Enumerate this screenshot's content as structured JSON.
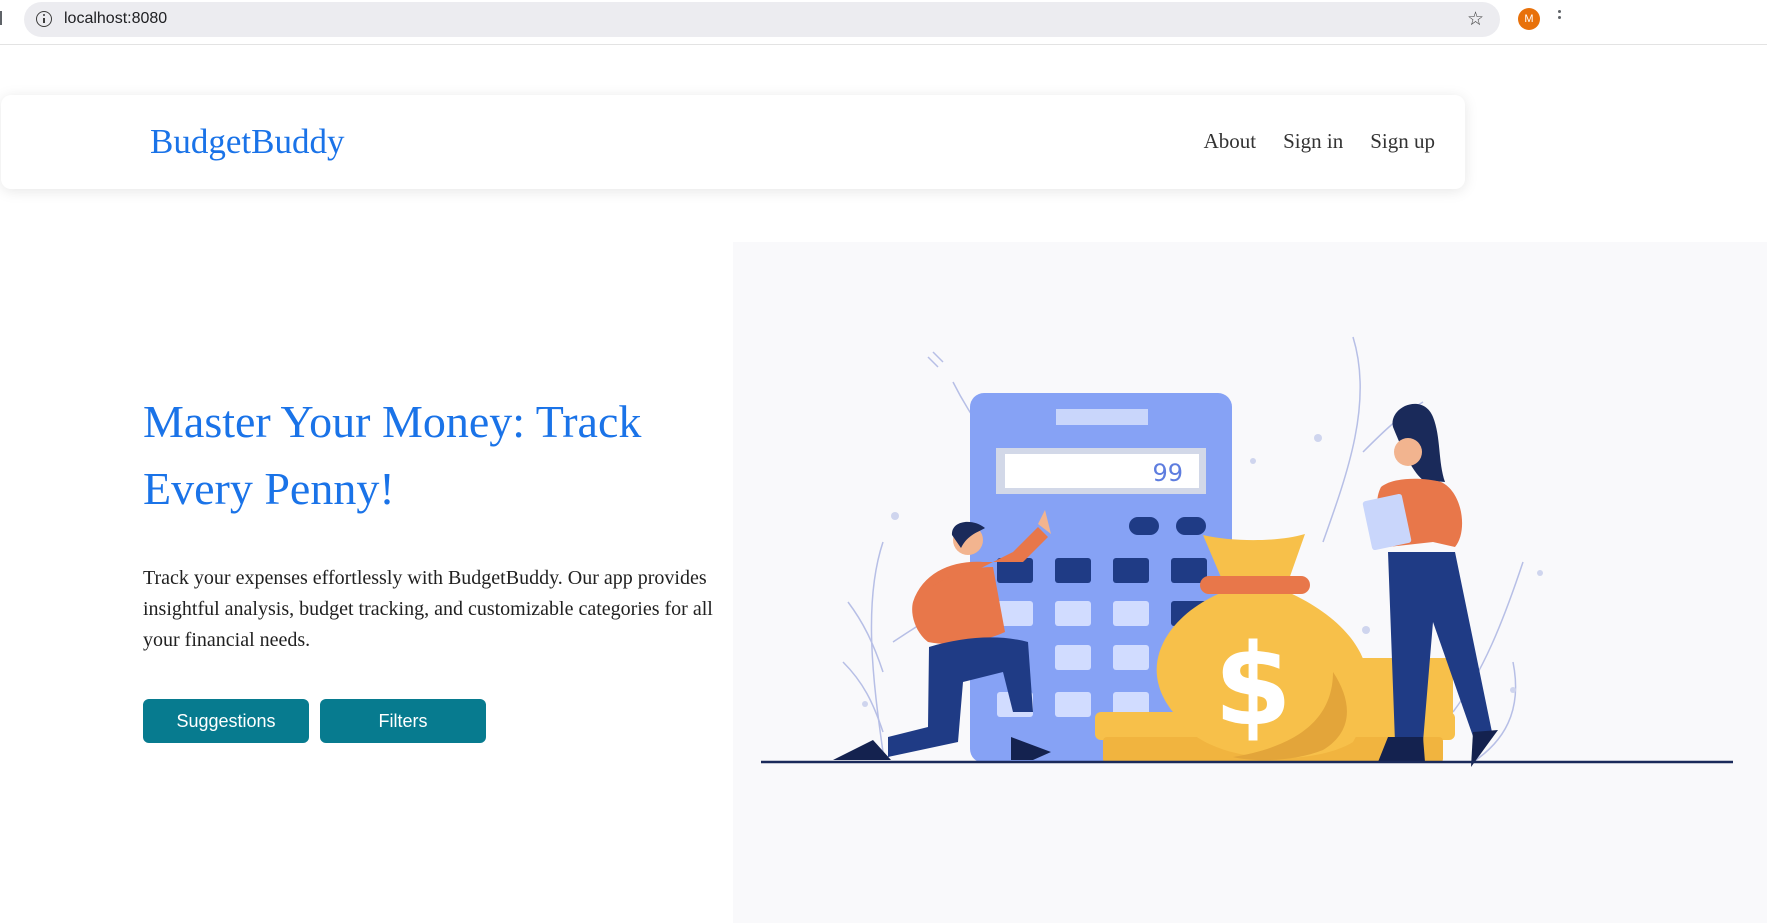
{
  "browser": {
    "url": "localhost:8080",
    "avatar_initial": "M",
    "icons": [
      "info-icon",
      "star-icon",
      "menu-icon"
    ]
  },
  "navbar": {
    "brand": "BudgetBuddy",
    "links": [
      "About",
      "Sign in",
      "Sign up"
    ]
  },
  "hero": {
    "title": "Master Your Money: Track Every Penny!",
    "description": "Track your expenses effortlessly with BudgetBuddy. Our app provides insightful analysis, budget tracking, and customizable categories for all your financial needs.",
    "buttons": [
      "Suggestions",
      "Filters"
    ]
  },
  "illustration": {
    "calculator_display": "99",
    "money_bag_symbol": "$"
  },
  "colors": {
    "brand_blue": "#1a73e8",
    "button_teal": "#077b8f",
    "calculator_blue": "#86a2f5",
    "gold": "#f7c04a",
    "orange": "#e8774a",
    "navy": "#1f3b85"
  }
}
